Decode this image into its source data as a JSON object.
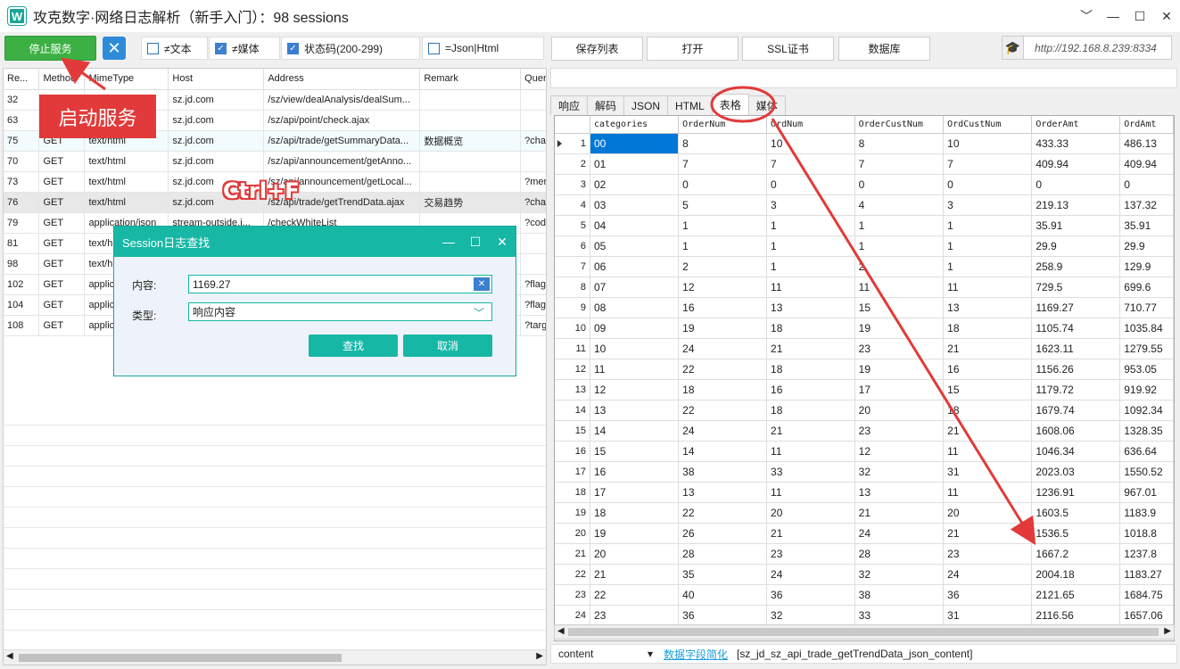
{
  "window": {
    "title": "攻克数字·网络日志解析（新手入门）：98 sessions",
    "icon": "app-w-icon",
    "icon_letter": "W",
    "controls": [
      "﹀",
      "—",
      "☐",
      "✕"
    ]
  },
  "toolbar": {
    "stop_label": "停止服务",
    "chk_text": "≠文本",
    "chk_text_on": false,
    "chk_media": "≠媒体",
    "chk_media_on": true,
    "chk_status": "状态码(200-299)",
    "chk_status_on": true,
    "chk_json": "=Json|Html",
    "chk_json_on": false,
    "btn_save": "保存列表",
    "btn_open": "打开",
    "btn_ssl": "SSL证书",
    "btn_db": "数据库",
    "url": "http://192.168.8.239:8334"
  },
  "sessions": {
    "headers": [
      "Re...",
      "Method",
      "MimeType",
      "Host",
      "Address",
      "Remark",
      "Quer"
    ],
    "rows": [
      [
        "32",
        "",
        "",
        "sz.jd.com",
        "/sz/view/dealAnalysis/dealSum...",
        "",
        ""
      ],
      [
        "63",
        "",
        "",
        "sz.jd.com",
        "/sz/api/point/check.ajax",
        "",
        ""
      ],
      [
        "75",
        "GET",
        "text/html",
        "sz.jd.com",
        "/sz/api/trade/getSummaryData...",
        "数据概览",
        "?char"
      ],
      [
        "70",
        "GET",
        "text/html",
        "sz.jd.com",
        "/sz/api/announcement/getAnno...",
        "",
        ""
      ],
      [
        "73",
        "GET",
        "text/html",
        "sz.jd.com",
        "/sz/api/announcement/getLocal...",
        "",
        "?men"
      ],
      [
        "76",
        "GET",
        "text/html",
        "sz.jd.com",
        "/sz/api/trade/getTrendData.ajax",
        "交易趋势",
        "?char"
      ],
      [
        "79",
        "GET",
        "application/json",
        "stream-outside.j...",
        "/checkWhiteList",
        "",
        "?code"
      ],
      [
        "81",
        "GET",
        "text/h",
        "",
        "",
        "",
        ""
      ],
      [
        "98",
        "GET",
        "text/h",
        "",
        "",
        "",
        ""
      ],
      [
        "102",
        "GET",
        "applica",
        "",
        "",
        "",
        "?flag"
      ],
      [
        "104",
        "GET",
        "applica",
        "",
        "",
        "",
        "?flag"
      ],
      [
        "108",
        "GET",
        "applica",
        "",
        "",
        "",
        "?targ"
      ]
    ]
  },
  "annotations": {
    "start_service": "启动服务",
    "ctrl_f": "Ctrl+F"
  },
  "dialog": {
    "title": "Session日志查找",
    "content_label": "内容:",
    "content_value": "1169.27",
    "type_label": "类型:",
    "type_value": "响应内容",
    "find_label": "查找",
    "cancel_label": "取消"
  },
  "right": {
    "tabs": [
      "响应",
      "解码",
      "JSON",
      "HTML",
      "表格",
      "媒体"
    ],
    "active_tab": "表格",
    "columns": [
      "categories",
      "OrderNum",
      "OrdNum",
      "OrderCustNum",
      "OrdCustNum",
      "OrderAmt",
      "OrdAmt"
    ],
    "rows": [
      [
        "1",
        "00",
        "8",
        "10",
        "8",
        "10",
        "433.33",
        "486.13"
      ],
      [
        "2",
        "01",
        "7",
        "7",
        "7",
        "7",
        "409.94",
        "409.94"
      ],
      [
        "3",
        "02",
        "0",
        "0",
        "0",
        "0",
        "0",
        "0"
      ],
      [
        "4",
        "03",
        "5",
        "3",
        "4",
        "3",
        "219.13",
        "137.32"
      ],
      [
        "5",
        "04",
        "1",
        "1",
        "1",
        "1",
        "35.91",
        "35.91"
      ],
      [
        "6",
        "05",
        "1",
        "1",
        "1",
        "1",
        "29.9",
        "29.9"
      ],
      [
        "7",
        "06",
        "2",
        "1",
        "2",
        "1",
        "258.9",
        "129.9"
      ],
      [
        "8",
        "07",
        "12",
        "11",
        "11",
        "11",
        "729.5",
        "699.6"
      ],
      [
        "9",
        "08",
        "16",
        "13",
        "15",
        "13",
        "1169.27",
        "710.77"
      ],
      [
        "10",
        "09",
        "19",
        "18",
        "19",
        "18",
        "1105.74",
        "1035.84"
      ],
      [
        "11",
        "10",
        "24",
        "21",
        "23",
        "21",
        "1623.11",
        "1279.55"
      ],
      [
        "12",
        "11",
        "22",
        "18",
        "19",
        "16",
        "1156.26",
        "953.05"
      ],
      [
        "13",
        "12",
        "18",
        "16",
        "17",
        "15",
        "1179.72",
        "919.92"
      ],
      [
        "14",
        "13",
        "22",
        "18",
        "20",
        "18",
        "1679.74",
        "1092.34"
      ],
      [
        "15",
        "14",
        "24",
        "21",
        "23",
        "21",
        "1608.06",
        "1328.35"
      ],
      [
        "16",
        "15",
        "14",
        "11",
        "12",
        "11",
        "1046.34",
        "636.64"
      ],
      [
        "17",
        "16",
        "38",
        "33",
        "32",
        "31",
        "2023.03",
        "1550.52"
      ],
      [
        "18",
        "17",
        "13",
        "11",
        "13",
        "11",
        "1236.91",
        "967.01"
      ],
      [
        "19",
        "18",
        "22",
        "20",
        "21",
        "20",
        "1603.5",
        "1183.9"
      ],
      [
        "20",
        "19",
        "26",
        "21",
        "24",
        "21",
        "1536.5",
        "1018.8"
      ],
      [
        "21",
        "20",
        "28",
        "23",
        "28",
        "23",
        "1667.2",
        "1237.8"
      ],
      [
        "22",
        "21",
        "35",
        "24",
        "32",
        "24",
        "2004.18",
        "1183.27"
      ],
      [
        "23",
        "22",
        "40",
        "36",
        "38",
        "36",
        "2121.65",
        "1684.75"
      ],
      [
        "24",
        "23",
        "36",
        "32",
        "33",
        "31",
        "2116.56",
        "1657.06"
      ]
    ],
    "bottom_combo": "content",
    "bottom_link": "数据字段简化",
    "bottom_path": "[sz_jd_sz_api_trade_getTrendData_json_content]"
  },
  "colors": {
    "accent": "#17b7a5",
    "annotation": "#e23a3a",
    "selection": "#0078d7",
    "stop_button": "#3cb043"
  }
}
